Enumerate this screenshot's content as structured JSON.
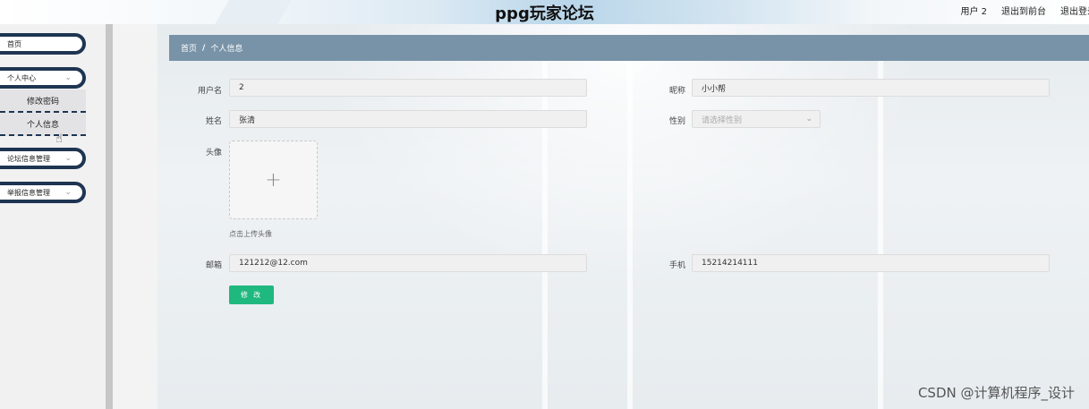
{
  "header": {
    "title": "ppg玩家论坛",
    "user_label": "用户 2",
    "to_front_label": "退出到前台",
    "logout_label": "退出登录"
  },
  "sidebar": {
    "home": "首页",
    "personal_center": "个人中心",
    "change_password": "修改密码",
    "personal_info": "个人信息",
    "forum_manage": "论坛信息管理",
    "report_manage": "举报信息管理"
  },
  "breadcrumb": {
    "home": "首页",
    "separator": "/",
    "current": "个人信息"
  },
  "form": {
    "username_label": "用户名",
    "username_value": "2",
    "nickname_label": "昵称",
    "nickname_value": "小小帮",
    "name_label": "姓名",
    "name_value": "张清",
    "gender_label": "性别",
    "gender_placeholder": "请选择性别",
    "avatar_label": "头像",
    "upload_hint": "点击上传头像",
    "email_label": "邮箱",
    "email_value": "121212@12.com",
    "phone_label": "手机",
    "phone_value": "15214214111",
    "submit_label": "修 改"
  },
  "watermark": "CSDN @计算机程序_设计",
  "colors": {
    "breadcrumb_bg": "#7893a8",
    "menu_border": "#1e3552",
    "submit_bg": "#1fb87f"
  }
}
